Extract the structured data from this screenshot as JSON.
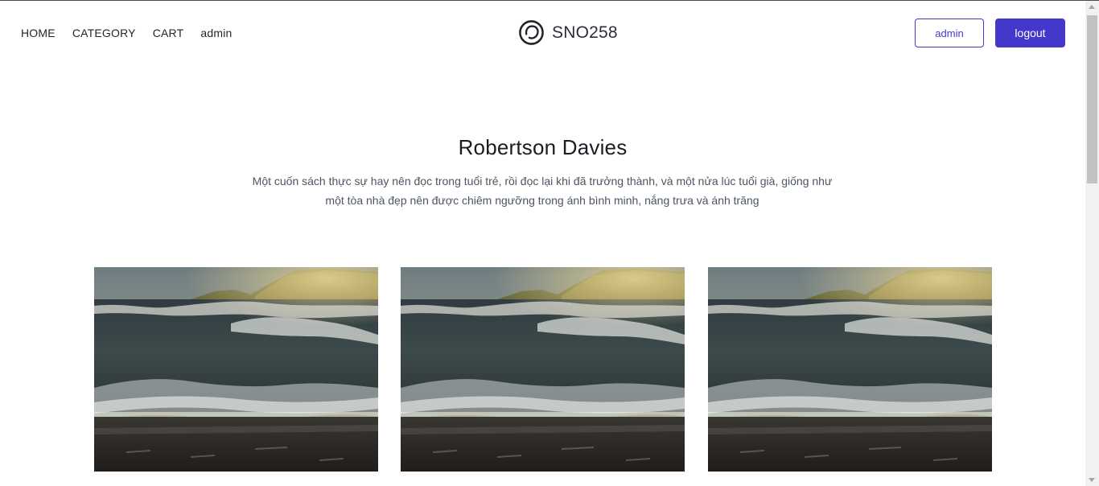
{
  "nav": {
    "items": [
      {
        "label": "HOME"
      },
      {
        "label": "CATEGORY"
      },
      {
        "label": "CART"
      }
    ],
    "user_label": "admin"
  },
  "brand": {
    "name": "SNO258",
    "logo_icon": "ring-logo-icon"
  },
  "actions": {
    "account_label": "admin",
    "logout_label": "logout"
  },
  "hero": {
    "title": "Robertson Davies",
    "line1": "Một cuốn sách thực sự hay nên đọc trong tuổi trẻ, rồi đọc lại khi đã trưởng thành, và một nửa lúc tuổi già, giống như",
    "line2": "một tòa nhà đẹp nên được chiêm ngưỡng trong ánh bình minh, nắng trưa và ánh trăng"
  },
  "gallery": {
    "images": [
      {
        "subject": "ocean-waves-beach-image"
      },
      {
        "subject": "ocean-waves-beach-image"
      },
      {
        "subject": "ocean-waves-beach-image"
      }
    ]
  },
  "colors": {
    "accent": "#4338ca",
    "text": "#1f2329",
    "muted": "#4b5563"
  }
}
